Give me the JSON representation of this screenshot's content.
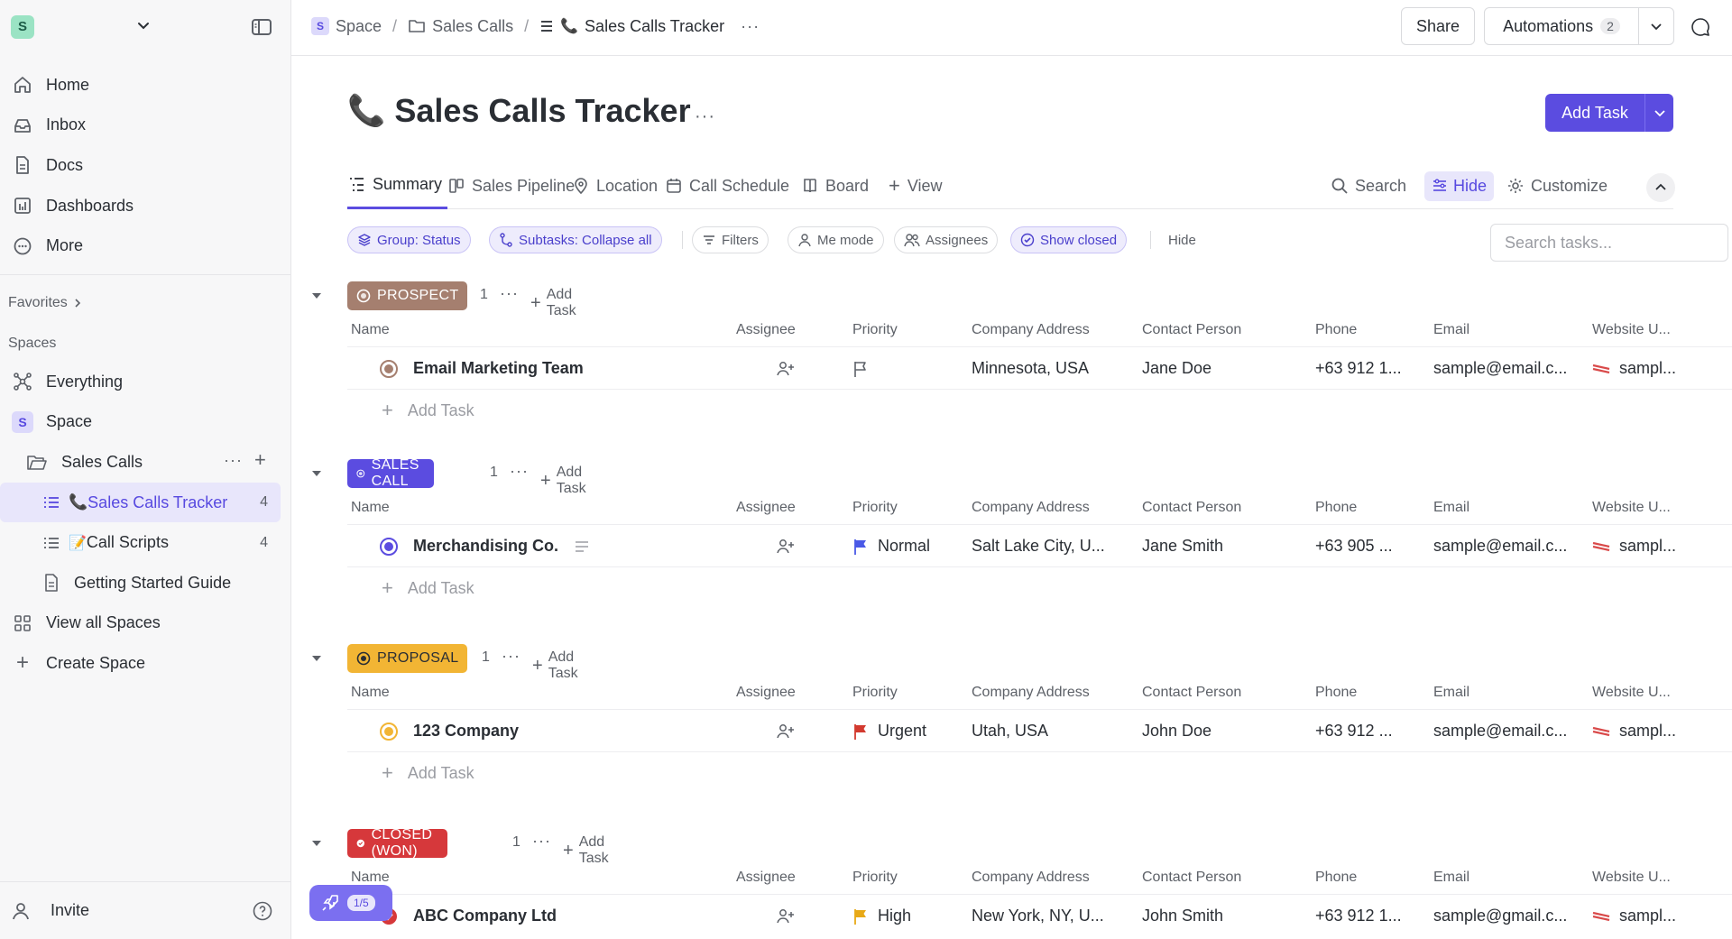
{
  "sidebar": {
    "workspace_initial": "S",
    "nav": [
      {
        "label": "Home",
        "icon": "home-icon"
      },
      {
        "label": "Inbox",
        "icon": "inbox-icon"
      },
      {
        "label": "Docs",
        "icon": "docs-icon"
      },
      {
        "label": "Dashboards",
        "icon": "dashboards-icon"
      },
      {
        "label": "More",
        "icon": "more-icon"
      }
    ],
    "favorites_label": "Favorites",
    "spaces_label": "Spaces",
    "tree": {
      "everything": "Everything",
      "space_initial": "S",
      "space": "Space",
      "folder": "Sales Calls",
      "list_active": "Sales Calls Tracker",
      "list_active_emoji": "📞",
      "list_active_count": "4",
      "list2": "Call Scripts",
      "list2_emoji": "📝",
      "list2_count": "4",
      "doc": "Getting Started Guide",
      "view_all": "View all Spaces",
      "create": "Create Space"
    },
    "invite": "Invite"
  },
  "topbar": {
    "crumb_space_initial": "S",
    "crumb_space": "Space",
    "crumb_folder": "Sales Calls",
    "crumb_list": "Sales Calls Tracker",
    "crumb_list_emoji": "📞",
    "share": "Share",
    "automations": "Automations",
    "automations_count": "2"
  },
  "page": {
    "title": "Sales Calls Tracker",
    "title_emoji": "📞",
    "add_task": "Add Task"
  },
  "tabs": {
    "items": [
      "Summary",
      "Sales Pipeline",
      "Location",
      "Call Schedule",
      "Board"
    ],
    "add_view": "View",
    "search": "Search",
    "hide": "Hide",
    "customize": "Customize"
  },
  "filters": {
    "group": "Group: Status",
    "subtasks": "Subtasks: Collapse all",
    "filters": "Filters",
    "me_mode": "Me mode",
    "assignees": "Assignees",
    "show_closed": "Show closed",
    "hide": "Hide",
    "search_placeholder": "Search tasks..."
  },
  "columns": {
    "name": "Name",
    "assignee": "Assignee",
    "priority": "Priority",
    "address": "Company Address",
    "contact": "Contact Person",
    "phone": "Phone",
    "email": "Email",
    "website": "Website U..."
  },
  "add_task_label": "Add Task",
  "add_task_row_label": "Add Task",
  "groups": [
    {
      "status": "PROSPECT",
      "color": "#a57f6f",
      "count": "1",
      "task": {
        "name": "Email Marketing Team",
        "priority": "",
        "priority_color": "",
        "address": "Minnesota, USA",
        "contact": "Jane Doe",
        "phone": "+63 912 1...",
        "email": "sample@email.c...",
        "website": "sampl..."
      }
    },
    {
      "status": "SALES CALL",
      "color": "#5b4ce0",
      "count": "1",
      "task": {
        "name": "Merchandising Co.",
        "priority": "Normal",
        "priority_color": "#4a59e6",
        "address": "Salt Lake City, U...",
        "contact": "Jane Smith",
        "phone": "+63 905 ...",
        "email": "sample@email.c...",
        "website": "sampl..."
      }
    },
    {
      "status": "PROPOSAL",
      "color": "#f2b534",
      "count": "1",
      "task": {
        "name": "123 Company",
        "priority": "Urgent",
        "priority_color": "#d33a2f",
        "address": "Utah, USA",
        "contact": "John Doe",
        "phone": "+63 912 ...",
        "email": "sample@email.c...",
        "website": "sampl..."
      }
    },
    {
      "status": "CLOSED (WON)",
      "color": "#d6383b",
      "count": "1",
      "task": {
        "name": "ABC Company Ltd",
        "priority": "High",
        "priority_color": "#e8a917",
        "address": "New York, NY, U...",
        "contact": "John Smith",
        "phone": "+63 912 1...",
        "email": "sample@gmail.c...",
        "website": "sampl..."
      }
    }
  ],
  "tour": {
    "progress": "1/5"
  }
}
